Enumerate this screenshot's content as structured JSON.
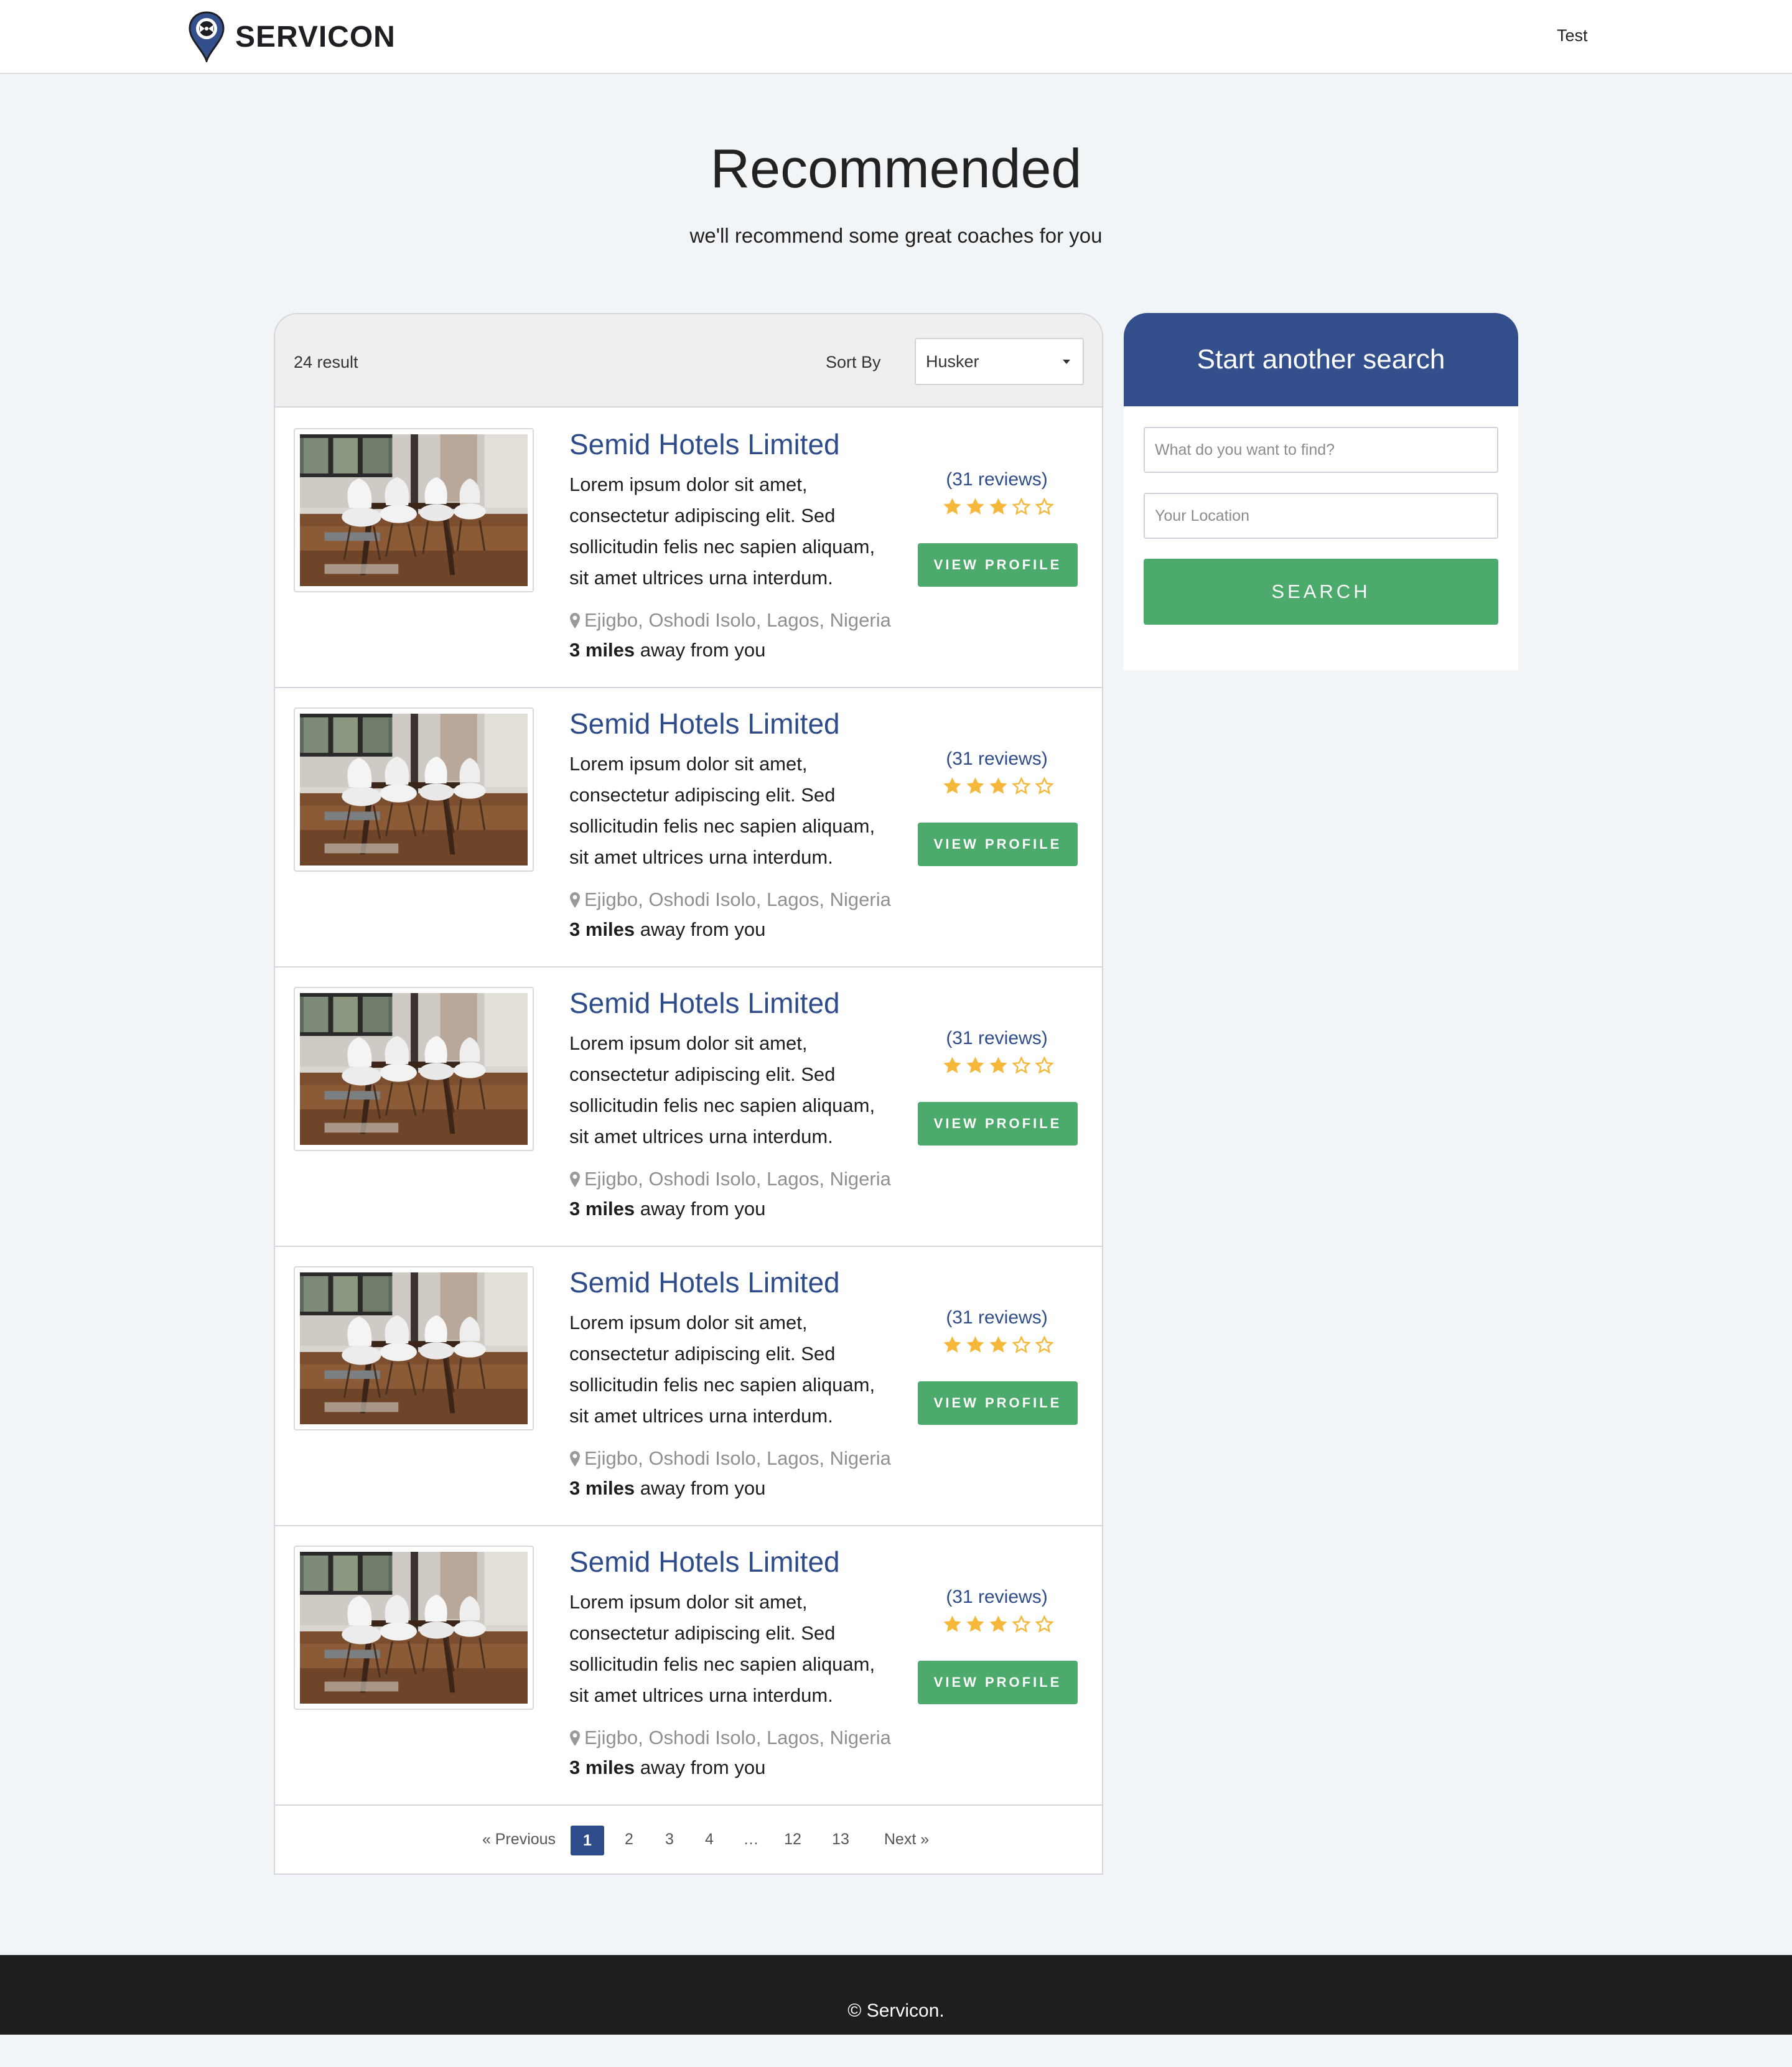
{
  "header": {
    "brand": "SERVICON",
    "user_link": "Test"
  },
  "hero": {
    "title": "Recommended",
    "subtitle": "we'll recommend some great coaches for you"
  },
  "results": {
    "count_label": "24 result",
    "sort_label": "Sort By",
    "sort_value": "Husker",
    "items": [
      {
        "title": "Semid Hotels Limited",
        "description": "Lorem ipsum dolor sit amet, consectetur adipiscing elit. Sed sollicitudin felis nec sapien aliquam, sit amet ultrices urna interdum.",
        "location": "Ejigbo, Oshodi Isolo, Lagos, Nigeria",
        "distance_value": "3 miles",
        "distance_suffix": " away from you",
        "reviews": "(31 reviews)",
        "rating": 3,
        "rating_max": 5,
        "button_label": "VIEW PROFILE"
      },
      {
        "title": "Semid Hotels Limited",
        "description": "Lorem ipsum dolor sit amet, consectetur adipiscing elit. Sed sollicitudin felis nec sapien aliquam, sit amet ultrices urna interdum.",
        "location": "Ejigbo, Oshodi Isolo, Lagos, Nigeria",
        "distance_value": "3 miles",
        "distance_suffix": " away from you",
        "reviews": "(31 reviews)",
        "rating": 3,
        "rating_max": 5,
        "button_label": "VIEW PROFILE"
      },
      {
        "title": "Semid Hotels Limited",
        "description": "Lorem ipsum dolor sit amet, consectetur adipiscing elit. Sed sollicitudin felis nec sapien aliquam, sit amet ultrices urna interdum.",
        "location": "Ejigbo, Oshodi Isolo, Lagos, Nigeria",
        "distance_value": "3 miles",
        "distance_suffix": " away from you",
        "reviews": "(31 reviews)",
        "rating": 3,
        "rating_max": 5,
        "button_label": "VIEW PROFILE"
      },
      {
        "title": "Semid Hotels Limited",
        "description": "Lorem ipsum dolor sit amet, consectetur adipiscing elit. Sed sollicitudin felis nec sapien aliquam, sit amet ultrices urna interdum.",
        "location": "Ejigbo, Oshodi Isolo, Lagos, Nigeria",
        "distance_value": "3 miles",
        "distance_suffix": " away from you",
        "reviews": "(31 reviews)",
        "rating": 3,
        "rating_max": 5,
        "button_label": "VIEW PROFILE"
      },
      {
        "title": "Semid Hotels Limited",
        "description": "Lorem ipsum dolor sit amet, consectetur adipiscing elit. Sed sollicitudin felis nec sapien aliquam, sit amet ultrices urna interdum.",
        "location": "Ejigbo, Oshodi Isolo, Lagos, Nigeria",
        "distance_value": "3 miles",
        "distance_suffix": " away from you",
        "reviews": "(31 reviews)",
        "rating": 3,
        "rating_max": 5,
        "button_label": "VIEW PROFILE"
      }
    ],
    "pagination": {
      "previous": "« Previous",
      "pages": [
        "1",
        "2",
        "3",
        "4",
        "…",
        "12",
        "13"
      ],
      "current": "1",
      "next": "Next »"
    }
  },
  "search": {
    "title": "Start another search",
    "query_placeholder": "What do you want to find?",
    "location_placeholder": "Your Location",
    "button_label": "SEARCH"
  },
  "footer": {
    "copyright": "© Servicon."
  },
  "colors": {
    "brand_blue": "#2f4c8a",
    "search_header": "#34508c",
    "accent_green": "#4cab6c",
    "star_yellow": "#f5b83a",
    "page_bg": "#f2f5f8",
    "footer_bg": "#1d1e20"
  },
  "icons": {
    "logo": "location-pin-logo-icon",
    "location": "map-marker-icon",
    "star_filled": "star-filled-icon",
    "star_empty": "star-outline-icon",
    "dropdown": "caret-down-icon"
  }
}
